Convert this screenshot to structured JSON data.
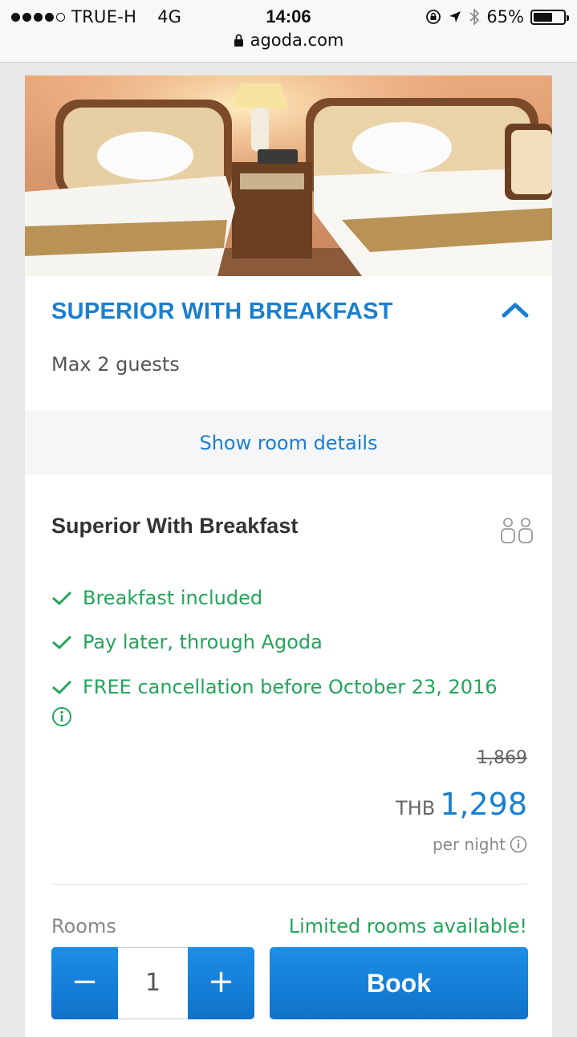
{
  "status_bar": {
    "carrier": "TRUE-H",
    "network": "4G",
    "time": "14:06",
    "battery": "65%",
    "battery_level": 0.65
  },
  "browser": {
    "url": "agoda.com"
  },
  "room": {
    "title": "SUPERIOR WITH BREAKFAST",
    "max_guests": "Max 2 guests",
    "show_details": "Show room details"
  },
  "offer": {
    "name": "Superior With Breakfast",
    "features": [
      "Breakfast included",
      "Pay later, through Agoda",
      "FREE cancellation before October 23, 2016"
    ],
    "old_price": "1,869",
    "currency": "THB",
    "price": "1,298",
    "per_night": "per night",
    "rooms_label": "Rooms",
    "availability": "Limited rooms available!",
    "rooms_count": "1",
    "minus": "−",
    "plus": "+",
    "book_label": "Book"
  },
  "colors": {
    "accent": "#1a7fd0",
    "success": "#22a55a",
    "button": "#1082d6"
  }
}
